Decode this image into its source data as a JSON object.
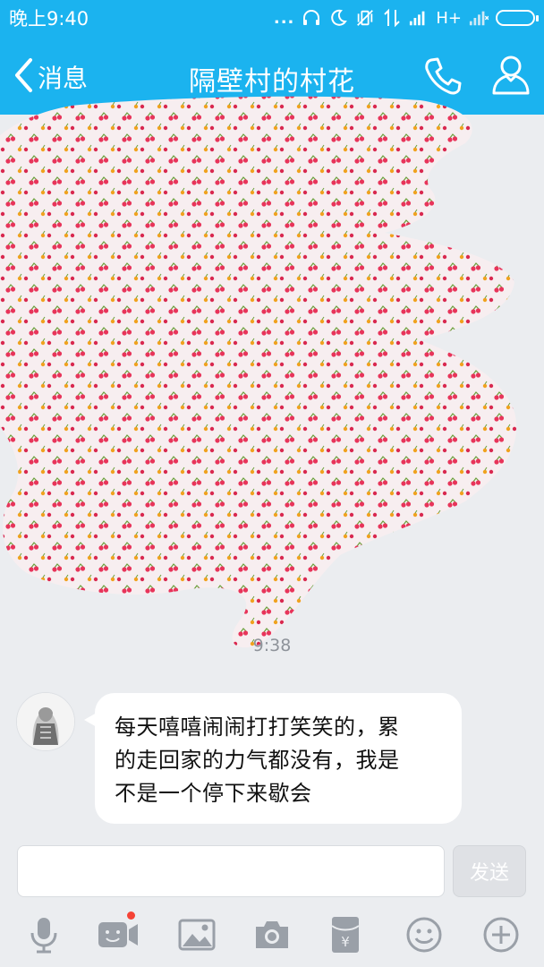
{
  "status_bar": {
    "time": "晚上9:40",
    "dots": "...",
    "network": "H+",
    "colors": {
      "background": "#1bb3ef",
      "text": "#ffffff"
    }
  },
  "header": {
    "back_label": "消息",
    "title": "隔壁村的村花",
    "icons": [
      "chevron-left-icon",
      "phone-icon",
      "profile-icon"
    ]
  },
  "chat": {
    "timestamp": "9:38",
    "messages": [
      {
        "side": "left",
        "avatar": "avatar",
        "lines": [
          "每天嘻嘻闹闹打打笑笑的，累",
          "的走回家的力气都没有，我是",
          "不是一个停下来歇会"
        ]
      }
    ],
    "redaction_pattern": "cherry-pattern"
  },
  "composer": {
    "input_value": "",
    "send_label": "发送",
    "tools": [
      "microphone-icon",
      "video-chat-icon",
      "image-icon",
      "camera-icon",
      "red-envelope-icon",
      "emoji-icon",
      "plus-icon"
    ],
    "video_badge_color": "#f54336"
  }
}
